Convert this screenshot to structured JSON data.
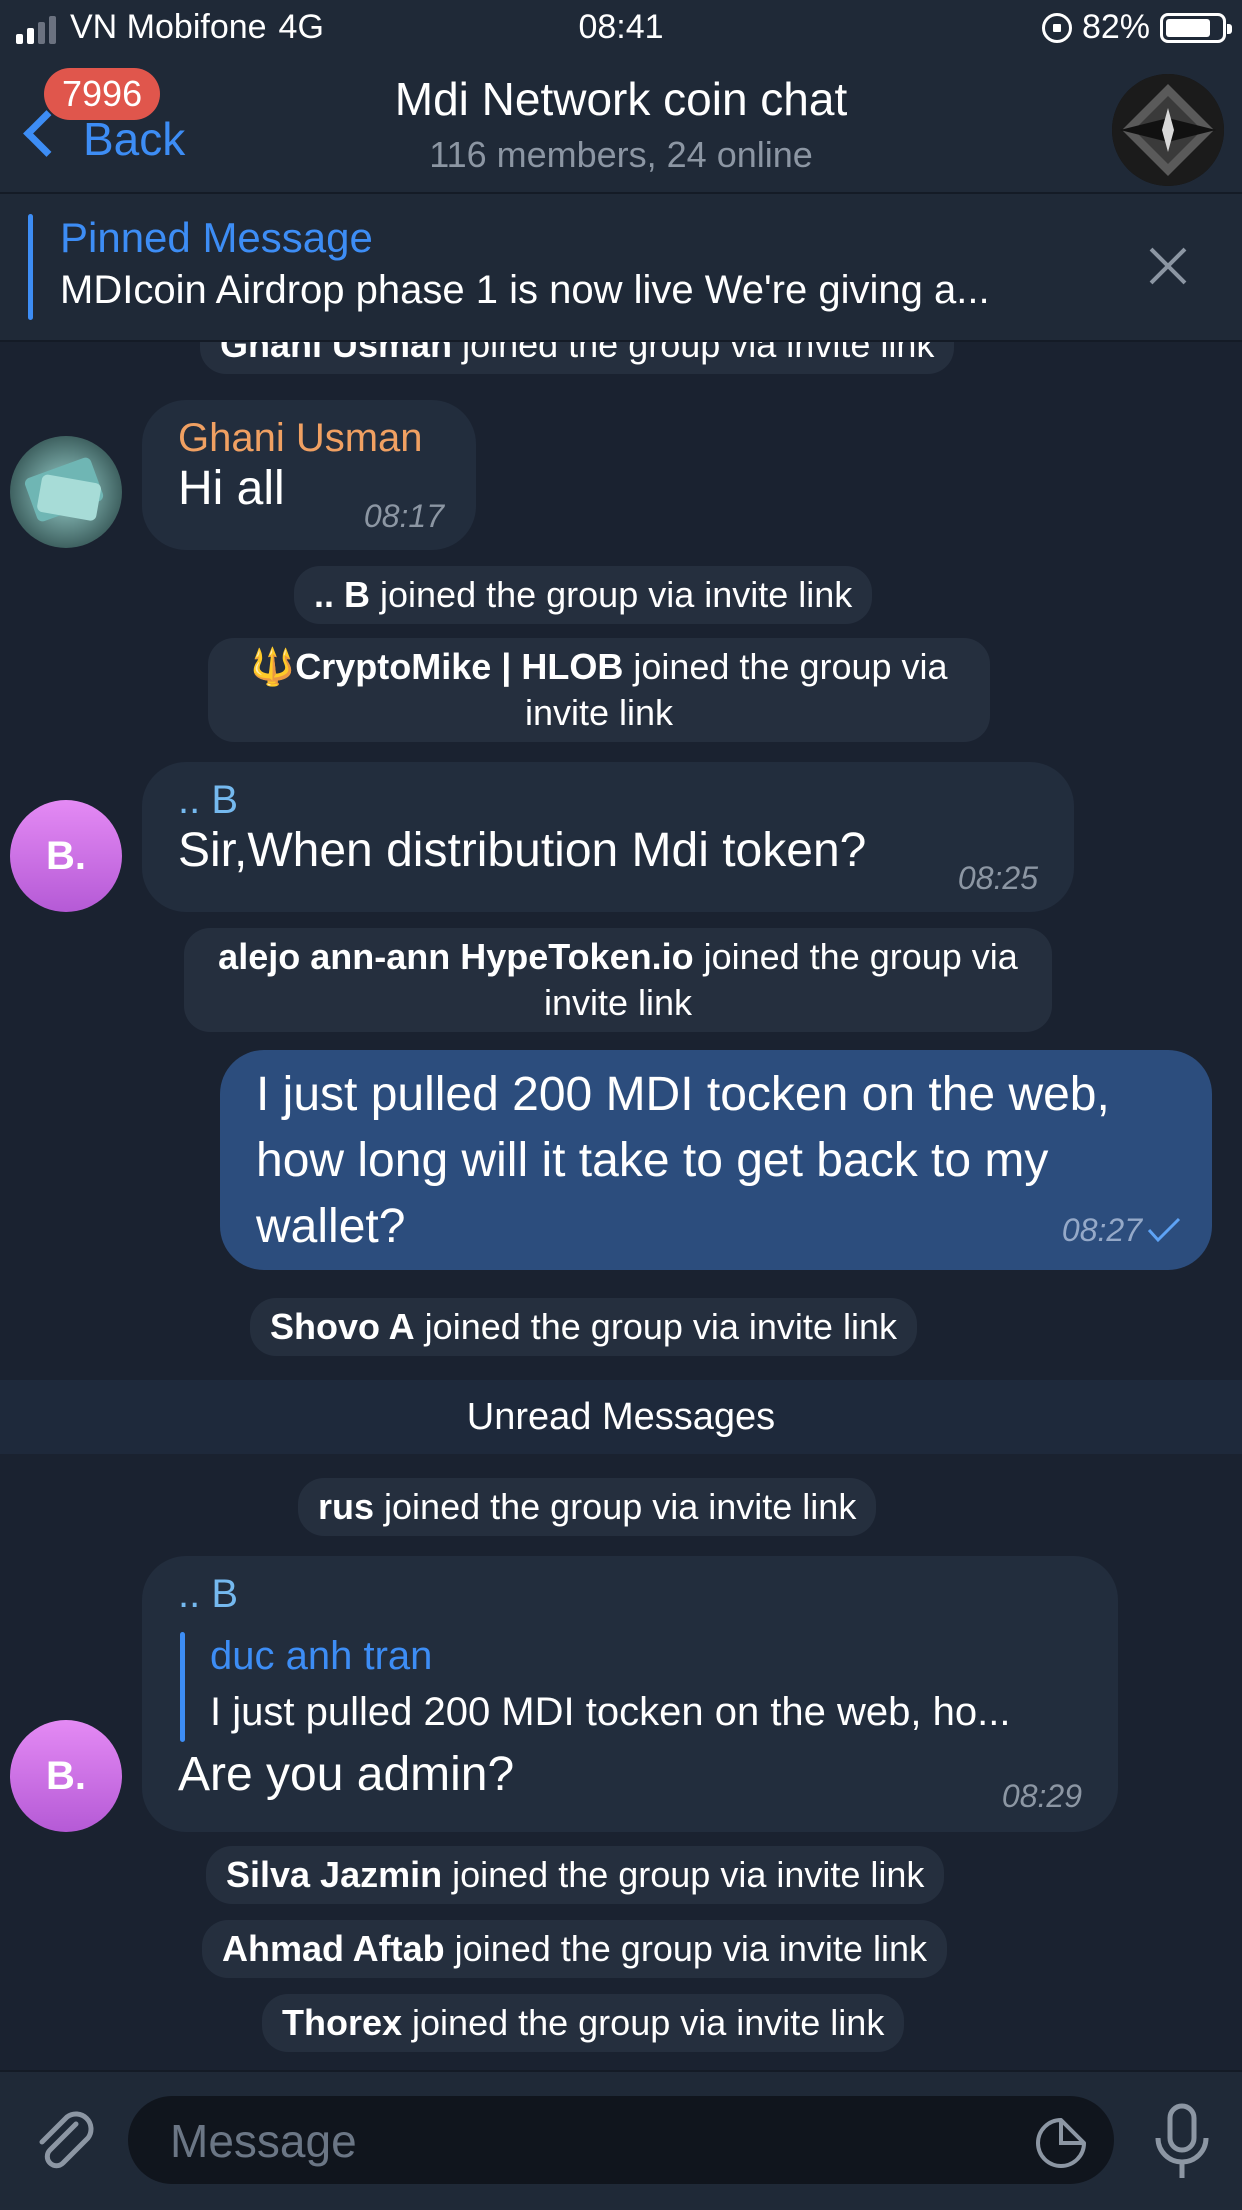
{
  "status_bar": {
    "carrier": "VN Mobifone",
    "network": "4G",
    "time": "08:41",
    "battery_percent": "82%",
    "battery_level": 0.82
  },
  "header": {
    "back_label": "Back",
    "unread_badge": "7996",
    "title": "Mdi Network coin chat",
    "subtitle": "116 members, 24 online"
  },
  "pinned": {
    "title": "Pinned Message",
    "text": "MDIcoin Airdrop phase 1 is now live We're giving a..."
  },
  "messages": {
    "svc_ghani": {
      "name": "Ghani Usman",
      "text": " joined the group via invite link"
    },
    "msg_ghani": {
      "sender": "Ghani Usman",
      "text": "Hi all",
      "time": "08:17"
    },
    "svc_b": {
      "name": ".. B",
      "text": " joined the group via invite link"
    },
    "svc_cryptomike": {
      "name": "🔱CryptoMike | HLOB",
      "text": " joined the group via invite link"
    },
    "msg_b1": {
      "sender": ".. B",
      "avatar_initials": "B.",
      "text": "Sir,When distribution Mdi token?",
      "time": "08:25"
    },
    "svc_alejo": {
      "name": "alejo ann-ann HypeToken.io",
      "text": " joined the group via invite link"
    },
    "msg_out": {
      "text": "I just pulled 200 MDI tocken on the web, how long will it take to get back to my wallet?",
      "time": "08:27"
    },
    "svc_shovo": {
      "name": "Shovo A",
      "text": " joined the group via invite link"
    },
    "unread_label": "Unread Messages",
    "svc_rus": {
      "name": "rus",
      "text": " joined the group via invite link"
    },
    "msg_b2": {
      "sender": ".. B",
      "avatar_initials": "B.",
      "reply_to_name": "duc anh tran",
      "reply_to_text": "I just pulled 200 MDI tocken on the web, ho...",
      "text": "Are you admin?",
      "time": "08:29"
    },
    "svc_silva": {
      "name": "Silva Jazmin",
      "text": " joined the group via invite link"
    },
    "svc_ahmad": {
      "name": "Ahmad Aftab",
      "text": " joined the group via invite link"
    },
    "svc_thorex": {
      "name": "Thorex",
      "text": " joined the group via invite link"
    }
  },
  "input": {
    "placeholder": "Message"
  },
  "colors": {
    "accent": "#3d8df5",
    "badge": "#e0564c",
    "ghani_name": "#f0a062",
    "b_name": "#75b9ef",
    "outgoing_bubble": "#2c4d7d",
    "incoming_bubble": "#222d3d"
  },
  "icons": {
    "signal": "signal-bars-icon",
    "orientation_lock": "orientation-lock-icon",
    "battery": "battery-icon",
    "back": "chevron-left-icon",
    "close": "close-icon",
    "read_check": "check-icon",
    "attach": "paperclip-icon",
    "sticker": "sticker-icon",
    "mic": "microphone-icon"
  }
}
